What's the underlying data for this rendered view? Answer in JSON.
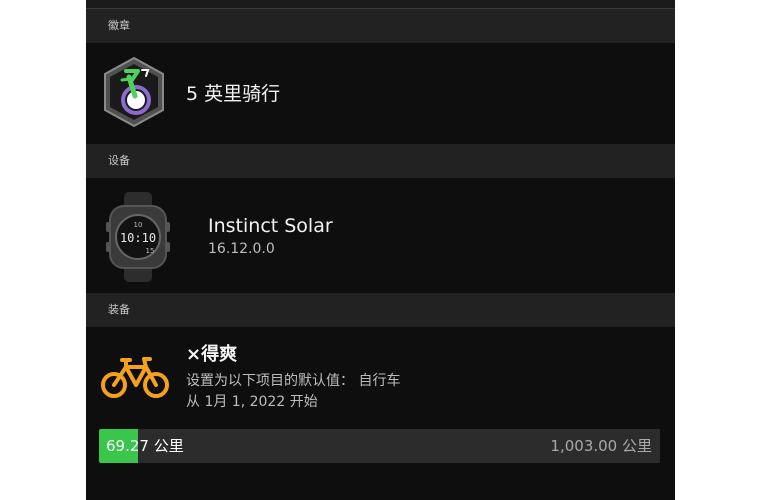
{
  "sections": {
    "badges_header": "徽章",
    "devices_header": "设备",
    "gear_header": "装备"
  },
  "badge": {
    "title": "5 英里骑行",
    "icon": "cycling-badge-icon"
  },
  "device": {
    "name": "Instinct Solar",
    "version": "16.12.0.0",
    "watch_face": {
      "time": "10:10",
      "top_text": "10",
      "side_text": "15"
    }
  },
  "gear": {
    "name": "×得爽",
    "default_for": "设置为以下项目的默认值： 自行车",
    "since": "从 1月 1, 2022 开始",
    "icon": "bike-icon",
    "distance_current": "69.27 公里",
    "distance_total": "1,003.00 公里",
    "progress_fraction": 0.069
  },
  "colors": {
    "accent_orange": "#f5a11c",
    "progress_green": "#39c64a",
    "badge_green": "#4fd15b",
    "badge_purple": "#8b6bd1"
  }
}
